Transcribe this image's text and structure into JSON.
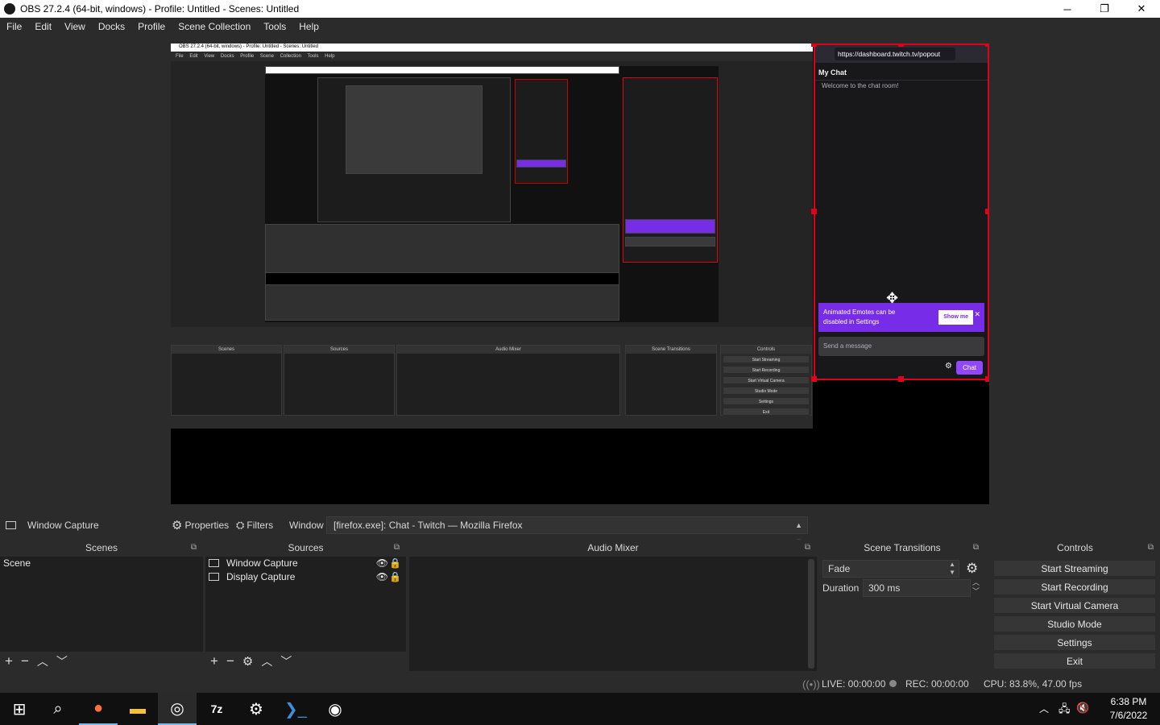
{
  "window": {
    "title": "OBS 27.2.4 (64-bit, windows) - Profile: Untitled - Scenes: Untitled",
    "minimize": "─",
    "maximize": "❐",
    "close": "✕"
  },
  "menu": [
    "File",
    "Edit",
    "View",
    "Docks",
    "Profile",
    "Scene Collection",
    "Tools",
    "Help"
  ],
  "preview": {
    "nested_title": "OBS 27.2.4 (64-bit, windows) - Profile: Untitled - Scenes: Untitled",
    "nested_menu": "File Edit View Docks Profile Scene Collection Tools Help",
    "chat": {
      "url": "https://dashboard.twitch.tv/popout",
      "header": "My Chat",
      "welcome": "Welcome to the chat room!",
      "promo_text": "Animated Emotes can be disabled in Settings",
      "promo_button": "Show me",
      "promo_close": "✕",
      "message_placeholder": "Send a message",
      "chat_button": "Chat"
    }
  },
  "source_toolbar": {
    "source_name": "Window Capture",
    "properties": "Properties",
    "filters": "Filters",
    "window_label": "Window",
    "window_value": "[firefox.exe]: Chat - Twitch — Mozilla Firefox"
  },
  "scenes": {
    "title": "Scenes",
    "items": [
      "Scene"
    ]
  },
  "sources": {
    "title": "Sources",
    "items": [
      "Window Capture",
      "Display Capture"
    ]
  },
  "audio_mixer": {
    "title": "Audio Mixer"
  },
  "scene_transitions": {
    "title": "Scene Transitions",
    "transition": "Fade",
    "duration_label": "Duration",
    "duration_value": "300 ms"
  },
  "controls": {
    "title": "Controls",
    "buttons": [
      "Start Streaming",
      "Start Recording",
      "Start Virtual Camera",
      "Studio Mode",
      "Settings",
      "Exit"
    ]
  },
  "status": {
    "live": "LIVE: 00:00:00",
    "rec": "REC: 00:00:00",
    "cpu": "CPU: 83.8%, 47.00 fps"
  },
  "taskbar": {
    "time": "6:38 PM",
    "date": "7/6/2022"
  }
}
